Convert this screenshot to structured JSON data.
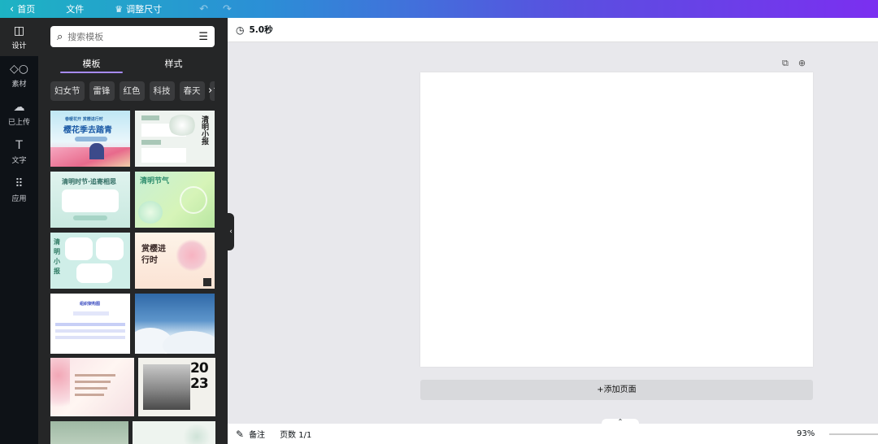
{
  "topbar": {
    "home": "首页",
    "file": "文件",
    "resize": "调整尺寸"
  },
  "rail": [
    {
      "label": "设计",
      "icon": "layout-icon"
    },
    {
      "label": "素材",
      "icon": "elements-icon"
    },
    {
      "label": "已上传",
      "icon": "upload-icon"
    },
    {
      "label": "文字",
      "icon": "text-icon"
    },
    {
      "label": "应用",
      "icon": "apps-icon"
    }
  ],
  "panel": {
    "search_placeholder": "搜索模板",
    "tabs": [
      "模板",
      "样式"
    ],
    "chips": [
      "妇女节",
      "雷锋",
      "红色",
      "科技",
      "春天",
      "古风"
    ]
  },
  "thumbs": [
    {
      "title": "樱花季去踏青",
      "sub": "春暖花开 赏樱进行时"
    },
    {
      "title": "清明小报",
      "sub": ""
    },
    {
      "title": "清明时节·追寄相思",
      "sub": ""
    },
    {
      "title": "清明节气",
      "sub": ""
    },
    {
      "title": "清明小报",
      "sub": ""
    },
    {
      "title": "赏樱进行时",
      "sub": ""
    },
    {
      "title": "组织架构图",
      "sub": ""
    },
    {
      "title": "",
      "sub": ""
    },
    {
      "title": "",
      "sub": ""
    },
    {
      "title": "2023",
      "sub": ""
    },
    {
      "title": "",
      "sub": ""
    },
    {
      "title": "",
      "sub": ""
    }
  ],
  "editor": {
    "duration": "5.0秒",
    "add_page": "+添加页面",
    "notes": "备注",
    "page_count": "页数 1/1",
    "zoom": "93%"
  }
}
